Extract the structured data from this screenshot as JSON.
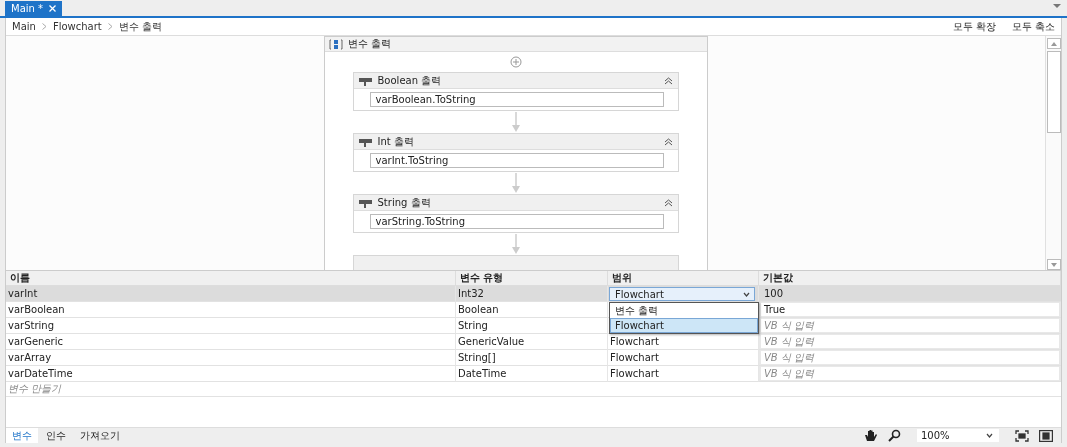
{
  "document_tab": {
    "label": "Main *",
    "selected": true
  },
  "breadcrumb": [
    "Main",
    "Flowchart",
    "변수 출력"
  ],
  "toolbar_links": [
    "모두 확장",
    "모두 축소"
  ],
  "sequence": {
    "title": "변수 출력",
    "activities": [
      {
        "title": "Boolean 출력",
        "expression": "varBoolean.ToString"
      },
      {
        "title": "Int 출력",
        "expression": "varInt.ToString"
      },
      {
        "title": "String 출력",
        "expression": "varString.ToString"
      }
    ]
  },
  "variables": {
    "columns": [
      "이름",
      "변수 유형",
      "범위",
      "기본값"
    ],
    "rows": [
      {
        "name": "varInt",
        "type": "Int32",
        "scope": "Flowchart",
        "default": "100",
        "selected": true
      },
      {
        "name": "varBoolean",
        "type": "Boolean",
        "default": "True",
        "selected": false
      },
      {
        "name": "varString",
        "type": "String",
        "default_placeholder": "VB 식 입력",
        "selected": false
      },
      {
        "name": "varGeneric",
        "type": "GenericValue",
        "scope": "Flowchart",
        "default_placeholder": "VB 식 입력",
        "selected": false
      },
      {
        "name": "varArray",
        "type": "String[]",
        "scope": "Flowchart",
        "default_placeholder": "VB 식 입력",
        "selected": false
      },
      {
        "name": "varDateTime",
        "type": "DateTime",
        "scope": "Flowchart",
        "default_placeholder": "VB 식 입력",
        "selected": false
      }
    ],
    "create_placeholder": "변수 만들기"
  },
  "scope_dropdown": {
    "options": [
      {
        "label": "변수 출력",
        "selected": false
      },
      {
        "label": "Flowchart",
        "selected": true
      }
    ]
  },
  "bottom_tabs": [
    {
      "label": "변수",
      "selected": true
    },
    {
      "label": "인수",
      "selected": false
    },
    {
      "label": "가져오기",
      "selected": false
    }
  ],
  "zoom": "100%"
}
